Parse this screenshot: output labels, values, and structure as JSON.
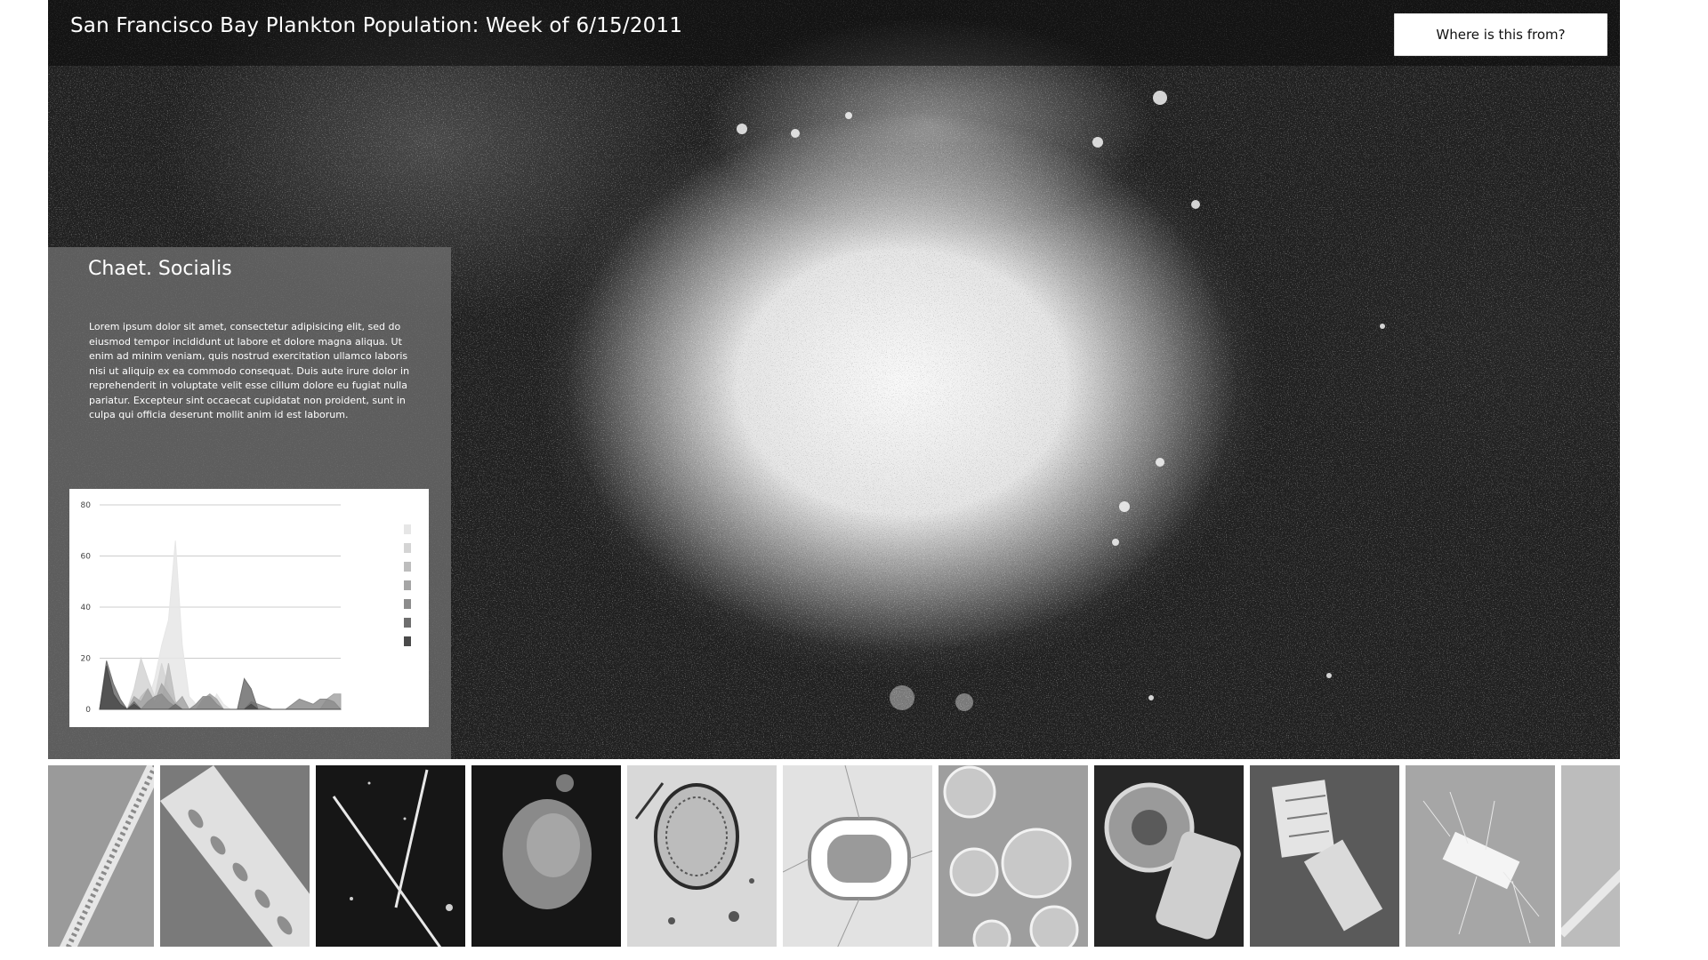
{
  "header": {
    "title": "San Francisco Bay Plankton Population: Week of 6/15/2011",
    "where_button_label": "Where is this from?"
  },
  "info_panel": {
    "species_name": "Chaet. Socialis",
    "description": "Lorem ipsum dolor sit amet, consectetur adipisicing elit, sed do eiusmod tempor incididunt ut labore et dolore magna aliqua. Ut enim ad minim veniam, quis nostrud exercitation ullamco laboris nisi ut aliquip ex ea commodo consequat. Duis aute irure dolor in reprehenderit in voluptate velit esse cillum dolore eu fugiat nulla pariatur. Excepteur sint occaecat cupidatat non proident, sunt in culpa qui officia deserunt mollit anim id est laborum."
  },
  "chart_data": {
    "type": "area",
    "ylim": [
      0,
      80
    ],
    "yticks": [
      "0",
      "20",
      "40",
      "60",
      "80"
    ],
    "grid": true,
    "legend": "right",
    "x": [
      0,
      1,
      2,
      3,
      4,
      5,
      6,
      7,
      8,
      9,
      10,
      11,
      12,
      13,
      14,
      15,
      16,
      17,
      18,
      19,
      20,
      21,
      22,
      23,
      24,
      25,
      26,
      27,
      28,
      29,
      30,
      31,
      32,
      33,
      34,
      35
    ],
    "series": [
      {
        "color": "#e6e6e6",
        "values": [
          0,
          0,
          0,
          0,
          0,
          0,
          0,
          3,
          12,
          25,
          35,
          66,
          25,
          5,
          2,
          0,
          0,
          6,
          2,
          0,
          0,
          0,
          0,
          0,
          0,
          0,
          0,
          0,
          0,
          0,
          0,
          0,
          0,
          0,
          0,
          0
        ]
      },
      {
        "color": "#d4d4d4",
        "values": [
          0,
          0,
          0,
          0,
          0,
          8,
          20,
          12,
          5,
          18,
          8,
          3,
          0,
          0,
          0,
          0,
          0,
          0,
          0,
          0,
          0,
          0,
          0,
          0,
          0,
          0,
          0,
          0,
          0,
          0,
          0,
          0,
          0,
          0,
          0,
          0
        ]
      },
      {
        "color": "#bdbdbd",
        "values": [
          0,
          0,
          0,
          0,
          0,
          0,
          5,
          8,
          2,
          3,
          18,
          3,
          0,
          0,
          0,
          3,
          6,
          2,
          0,
          0,
          0,
          0,
          0,
          0,
          0,
          0,
          0,
          0,
          0,
          0,
          0,
          0,
          0,
          0,
          0,
          0
        ]
      },
      {
        "color": "#a5a5a5",
        "values": [
          0,
          0,
          0,
          0,
          0,
          5,
          3,
          8,
          3,
          10,
          6,
          2,
          5,
          0,
          0,
          4,
          6,
          4,
          0,
          0,
          0,
          0,
          0,
          0,
          0,
          0,
          0,
          0,
          0,
          0,
          0,
          0,
          0,
          4,
          6,
          6
        ]
      },
      {
        "color": "#8c8c8c",
        "values": [
          0,
          0,
          0,
          0,
          0,
          0,
          0,
          3,
          5,
          6,
          3,
          1,
          0,
          0,
          2,
          5,
          5,
          2,
          0,
          0,
          0,
          0,
          3,
          2,
          1,
          0,
          0,
          0,
          2,
          4,
          3,
          2,
          4,
          4,
          3,
          0
        ]
      },
      {
        "color": "#6e6e6e",
        "values": [
          0,
          19,
          10,
          4,
          0,
          3,
          0,
          0,
          0,
          0,
          0,
          2,
          0,
          0,
          0,
          0,
          0,
          0,
          0,
          0,
          0,
          12,
          8,
          0,
          0,
          0,
          0,
          0,
          0,
          0,
          0,
          0,
          0,
          0,
          0,
          0
        ]
      },
      {
        "color": "#4a4a4a",
        "values": [
          0,
          17,
          6,
          2,
          0,
          2,
          0,
          0,
          0,
          0,
          0,
          0,
          0,
          0,
          0,
          0,
          0,
          0,
          0,
          0,
          0,
          0,
          2,
          0,
          0,
          0,
          0,
          0,
          0,
          0,
          0,
          0,
          0,
          0,
          0,
          0
        ]
      }
    ]
  },
  "filmstrip": {
    "thumbnails": [
      {
        "name": "thumb-chain-diatom-diagonal"
      },
      {
        "name": "thumb-ribbon-diatom"
      },
      {
        "name": "thumb-needle-diatoms"
      },
      {
        "name": "thumb-dark-colony"
      },
      {
        "name": "thumb-oval-cell"
      },
      {
        "name": "thumb-bright-capsule"
      },
      {
        "name": "thumb-round-cells-cluster"
      },
      {
        "name": "thumb-disc-and-barrel"
      },
      {
        "name": "thumb-glowing-colony"
      },
      {
        "name": "thumb-spiny-chain"
      },
      {
        "name": "thumb-partial-edge"
      }
    ]
  },
  "colors": {
    "background_dark": "#161616",
    "panel_gray": "#6e6e6e",
    "text_white": "#ffffff",
    "button_white": "#ffffff"
  }
}
